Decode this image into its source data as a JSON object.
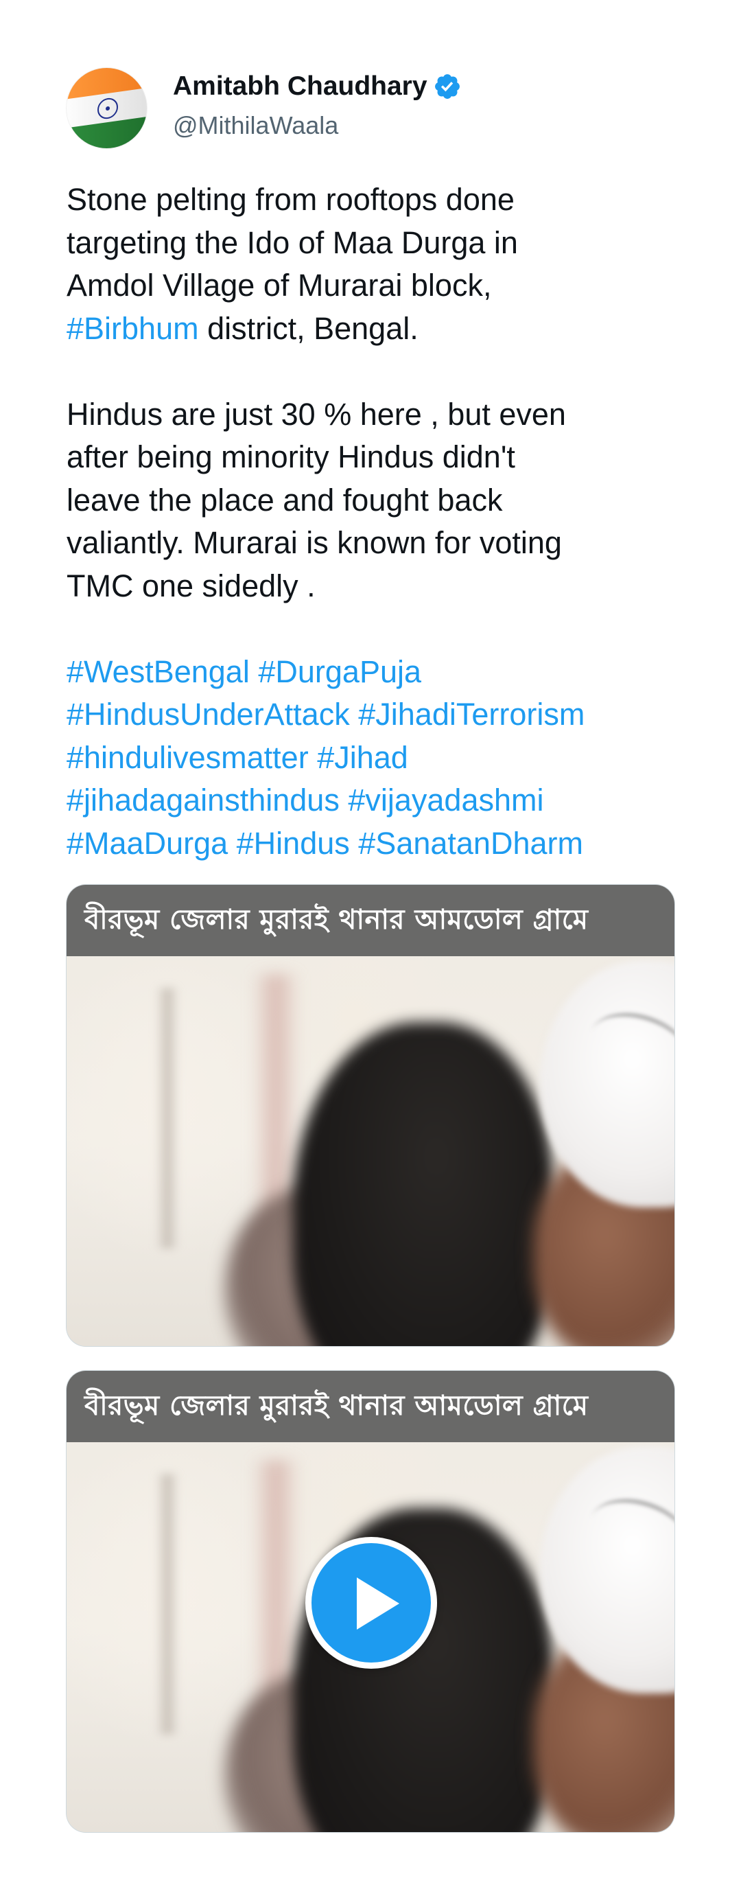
{
  "author": {
    "display_name": "Amitabh Chaudhary",
    "handle": "@MithilaWaala",
    "verified": true,
    "avatar_icon": "india-flag-avatar"
  },
  "tweet": {
    "lines": [
      [
        {
          "text": "Stone pelting from rooftops  done"
        }
      ],
      [
        {
          "text": "targeting the Ido of Maa Durga in"
        }
      ],
      [
        {
          "text": "Amdol Village of Murarai block,"
        }
      ],
      [
        {
          "text": "#Birbhum",
          "hashtag": true
        },
        {
          "text": " district, Bengal."
        }
      ],
      [],
      [
        {
          "text": "Hindus are just 30 % here  , but even"
        }
      ],
      [
        {
          "text": "after being minority Hindus didn't"
        }
      ],
      [
        {
          "text": "leave the place and fought back"
        }
      ],
      [
        {
          "text": "valiantly.  Murarai is known for voting"
        }
      ],
      [
        {
          "text": "TMC one sidedly ."
        }
      ],
      [],
      [
        {
          "text": "#WestBengal",
          "hashtag": true
        },
        {
          "text": " "
        },
        {
          "text": "#DurgaPuja",
          "hashtag": true
        }
      ],
      [
        {
          "text": "#HindusUnderAttack",
          "hashtag": true
        },
        {
          "text": " "
        },
        {
          "text": "#JihadiTerrorism",
          "hashtag": true
        }
      ],
      [
        {
          "text": "#hindulivesmatter",
          "hashtag": true
        },
        {
          "text": " "
        },
        {
          "text": "#Jihad",
          "hashtag": true
        }
      ],
      [
        {
          "text": "#jihadagainsthindus",
          "hashtag": true
        },
        {
          "text": " "
        },
        {
          "text": "#vijayadashmi",
          "hashtag": true
        }
      ],
      [
        {
          "text": "#MaaDurga",
          "hashtag": true
        },
        {
          "text": " "
        },
        {
          "text": "#Hindus",
          "hashtag": true
        },
        {
          "text": " "
        },
        {
          "text": "#SanatanDharm",
          "hashtag": true
        }
      ]
    ]
  },
  "media": [
    {
      "caption": "বীরভূম জেলার মুরারই থানার আমডোল গ্রামে",
      "has_play_button": false
    },
    {
      "caption": "বীরভূম জেলার মুরারই থানার আমডোল গ্রামে",
      "has_play_button": true
    }
  ],
  "colors": {
    "hashtag": "#1d9bf0",
    "text": "#0f1419",
    "secondary": "#536471",
    "play_button": "#1d9bf0"
  }
}
